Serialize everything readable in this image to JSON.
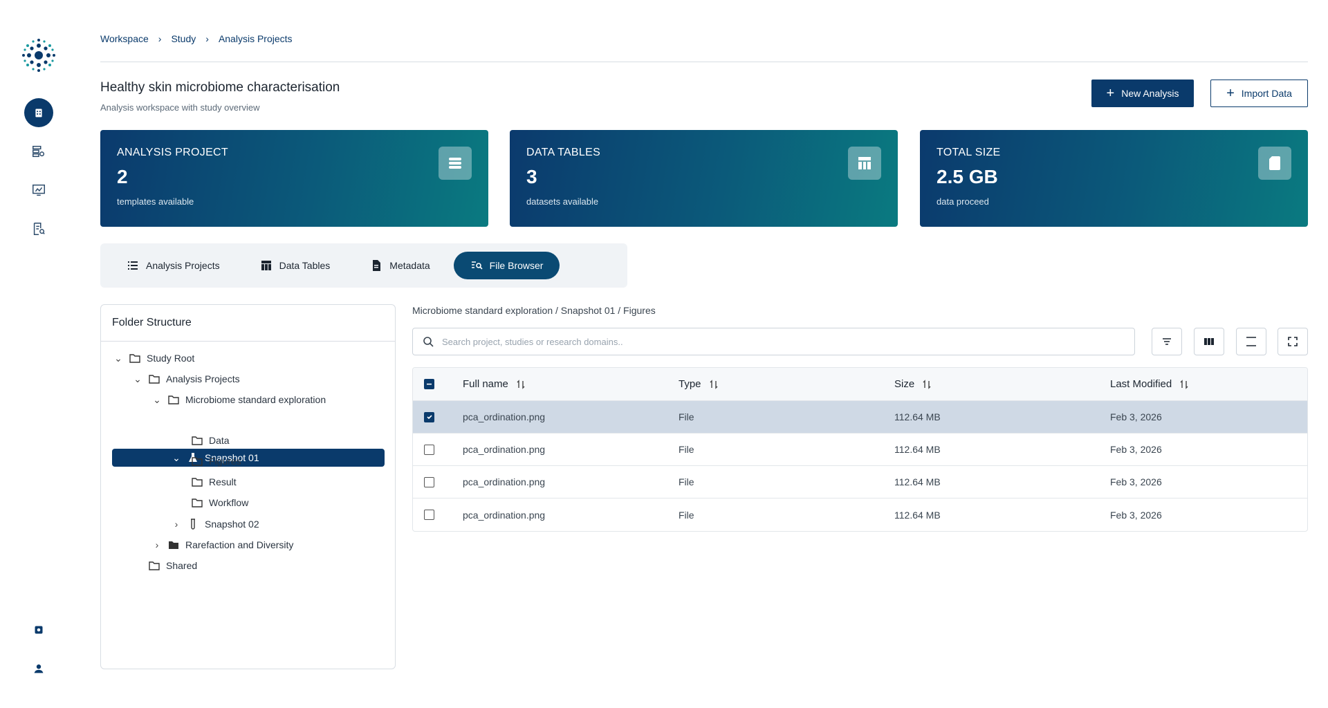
{
  "breadcrumb": [
    "Workspace",
    "Study",
    "Analysis Projects"
  ],
  "header": {
    "title": "Healthy skin microbiome characterisation",
    "subtitle": "Analysis workspace with study overview",
    "new_analysis": "New Analysis",
    "import_data": "Import Data"
  },
  "stats": [
    {
      "label": "ANALYSIS PROJECT",
      "value": "2",
      "note": "templates available",
      "icon": "list-icon"
    },
    {
      "label": "DATA TABLES",
      "value": "3",
      "note": "datasets available",
      "icon": "table-icon"
    },
    {
      "label": "TOTAL SIZE",
      "value": "2.5 GB",
      "note": "data proceed",
      "icon": "sd-card-icon"
    }
  ],
  "tabs": [
    {
      "label": "Analysis Projects",
      "icon": "list-icon",
      "active": false
    },
    {
      "label": "Data Tables",
      "icon": "table-icon",
      "active": false
    },
    {
      "label": "Metadata",
      "icon": "document-icon",
      "active": false
    },
    {
      "label": "File Browser",
      "icon": "file-search-icon",
      "active": true
    }
  ],
  "folder": {
    "title": "Folder Structure",
    "nodes": [
      {
        "label": "Study Root",
        "icon": "folder-icon",
        "expanded": true
      },
      {
        "label": "Analysis Projects",
        "icon": "folder-icon",
        "expanded": true
      },
      {
        "label": "Microbiome standard exploration",
        "icon": "folder-icon",
        "expanded": true
      },
      {
        "label": "Snapshot 01",
        "icon": "flask-icon",
        "expanded": true,
        "selected": true
      },
      {
        "label": "Data",
        "icon": "folder-icon"
      },
      {
        "label": "Figures",
        "icon": "folder-icon"
      },
      {
        "label": "Result",
        "icon": "folder-icon"
      },
      {
        "label": "Workflow",
        "icon": "folder-icon"
      },
      {
        "label": "Snapshot 02",
        "icon": "test-tube-icon",
        "expanded": false
      },
      {
        "label": "Rarefaction and Diversity",
        "icon": "folder-filled-icon",
        "expanded": false
      },
      {
        "label": "Shared",
        "icon": "folder-icon"
      }
    ]
  },
  "browser": {
    "path": "Microbiome standard exploration / Snapshot 01 / Figures",
    "search_placeholder": "Search project, studies or research domains..",
    "columns": [
      "Full name",
      "Type",
      "Size",
      "Last Modified"
    ],
    "rows": [
      {
        "name": "pca_ordination.png",
        "type": "File",
        "size": "112.64 MB",
        "modified": "Feb 3, 2026",
        "checked": true
      },
      {
        "name": "pca_ordination.png",
        "type": "File",
        "size": "112.64 MB",
        "modified": "Feb 3, 2026",
        "checked": false
      },
      {
        "name": "pca_ordination.png",
        "type": "File",
        "size": "112.64 MB",
        "modified": "Feb 3, 2026",
        "checked": false
      },
      {
        "name": "pca_ordination.png",
        "type": "File",
        "size": "112.64 MB",
        "modified": "Feb 3, 2026",
        "checked": false
      }
    ]
  },
  "colors": {
    "primary": "#0a3a6b",
    "teal": "#0a7a80",
    "selected_row": "#cfd9e5"
  }
}
